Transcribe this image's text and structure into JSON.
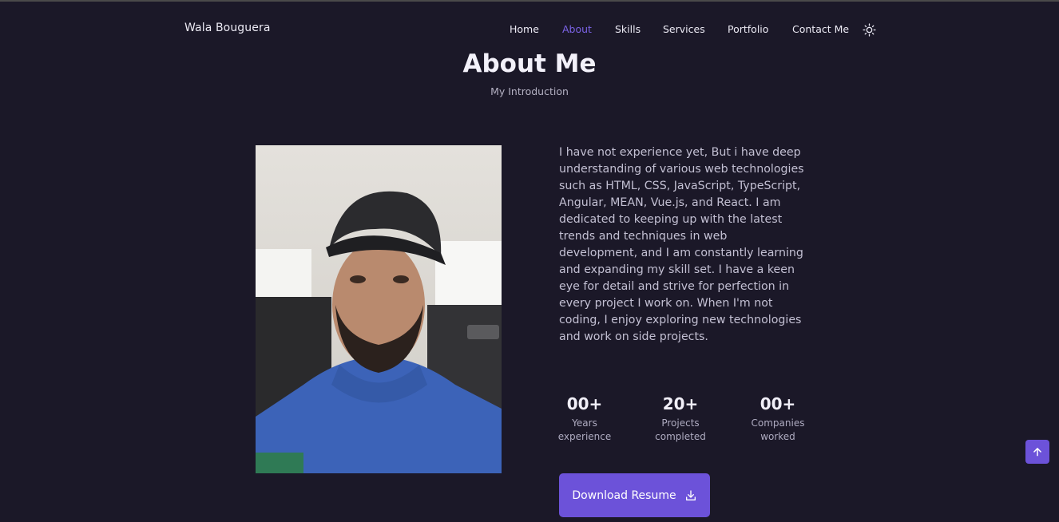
{
  "header": {
    "logo": "Wala Bouguera",
    "nav": [
      {
        "label": "Home",
        "active": false
      },
      {
        "label": "About",
        "active": true
      },
      {
        "label": "Skills",
        "active": false
      },
      {
        "label": "Services",
        "active": false
      },
      {
        "label": "Portfolio",
        "active": false
      },
      {
        "label": "Contact Me",
        "active": false
      }
    ],
    "theme_icon": "sun-icon"
  },
  "section": {
    "title": "About Me",
    "subtitle": "My Introduction"
  },
  "about": {
    "description": "I have not experience yet, But i have deep understanding of various web technologies such as HTML, CSS, JavaScript, TypeScript, Angular, MEAN, Vue.js, and React. I am dedicated to keeping up with the latest trends and techniques in web development, and I am constantly learning and expanding my skill set. I have a keen eye for detail and strive for perfection in every project I work on. When I'm not coding, I enjoy exploring new technologies and work on side projects.",
    "stats": [
      {
        "value": "00+",
        "label": "Years experience"
      },
      {
        "value": "20+",
        "label": "Projects completed"
      },
      {
        "value": "00+",
        "label": "Companies worked"
      }
    ],
    "button_label": "Download Resume",
    "button_icon": "download-icon"
  },
  "colors": {
    "background": "#1b1828",
    "accent": "#6c52d9",
    "active_nav": "#7b63e6"
  },
  "scroll_up_icon": "arrow-up-icon"
}
